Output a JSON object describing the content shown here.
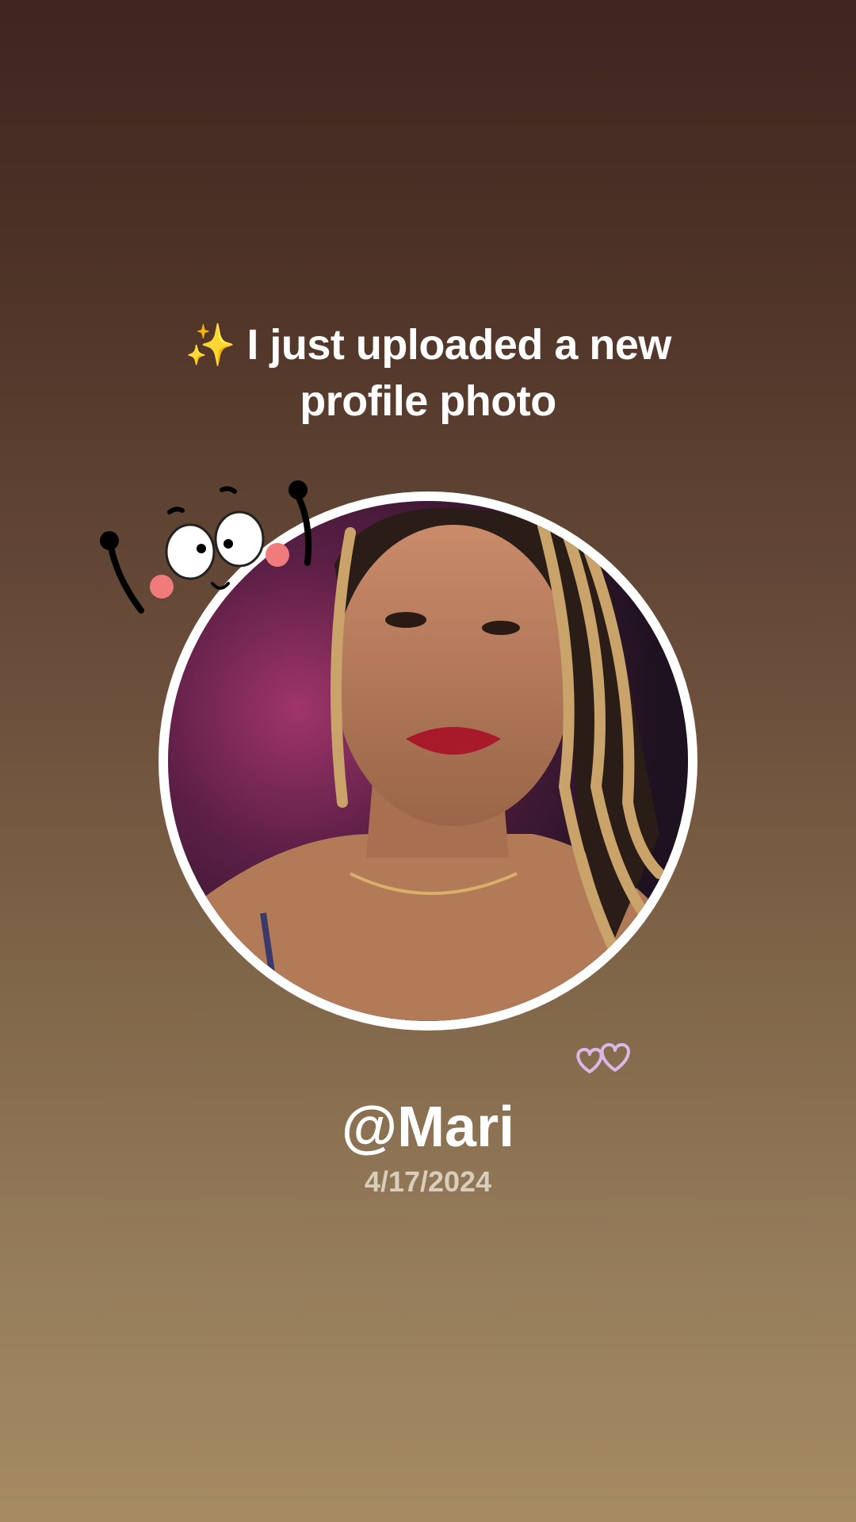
{
  "post": {
    "line1": "I just uploaded a new",
    "line2": "profile photo",
    "username": "@Mari",
    "date": "4/17/2024"
  },
  "icons": {
    "sparkle": "sparkles-icon",
    "doodle": "cartoon-face-sticker",
    "hearts": "hearts-sticker"
  },
  "colors": {
    "background_top": "#3f2520",
    "background_bottom": "#a68b62",
    "text": "#ffffff",
    "date_text": "#d9cdbb",
    "ring": "#ffffff"
  }
}
